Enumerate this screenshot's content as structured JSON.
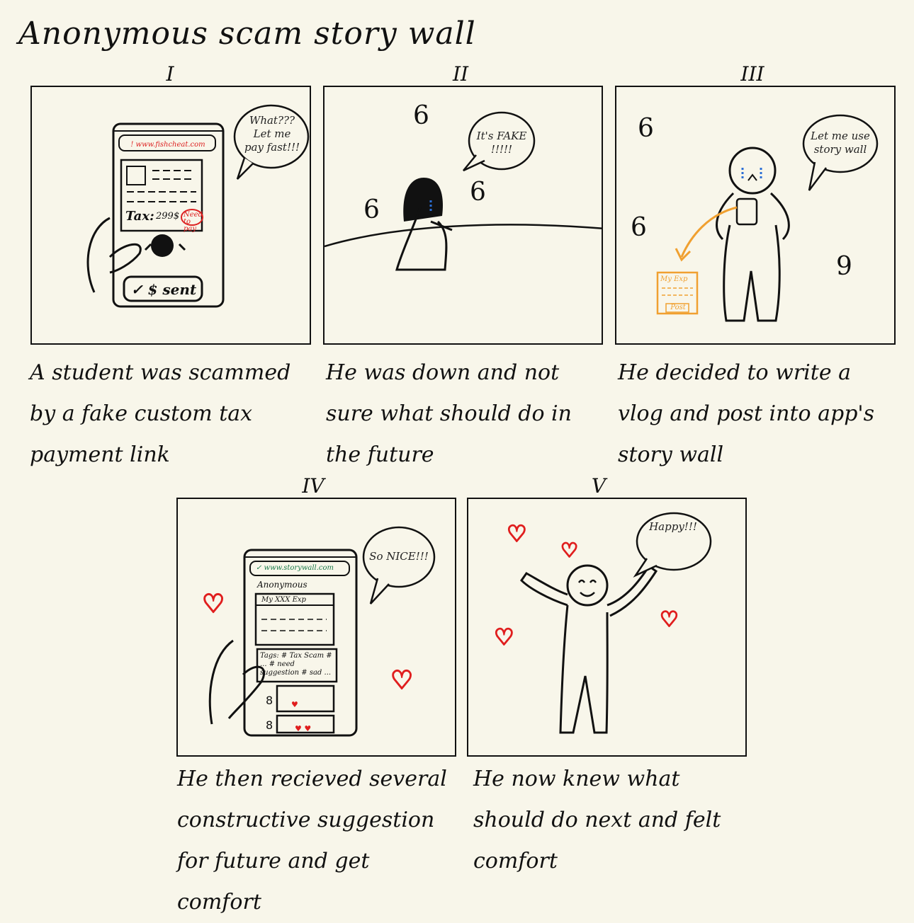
{
  "title": "Anonymous scam story wall",
  "colors": {
    "background": "#f8f6ea",
    "ink": "#111111",
    "heart": "#e01e1e",
    "tear": "#2b6fd6",
    "post_orange": "#f0a030",
    "url_red": "#d22222",
    "url_green": "#1a7a4a"
  },
  "panels": [
    {
      "numeral": "I",
      "bubble": "What??? Let me pay fast!!!",
      "url": "! www.fishcheat.com",
      "tax_label": "Tax:",
      "tax_value": "299$",
      "tax_note": "Need to pay",
      "sent_label": "✓ $ sent",
      "caption": "A student was scammed by a fake custom tax payment link"
    },
    {
      "numeral": "II",
      "bubble": "It's FAKE !!!!!",
      "caption": "He was down and not sure what should do in the future"
    },
    {
      "numeral": "III",
      "bubble": "Let me use story wall",
      "post_title": "My Exp",
      "post_button": "Post",
      "caption": "He decided to write a vlog and post into app's story wall"
    },
    {
      "numeral": "IV",
      "bubble": "So NICE!!!",
      "url": "✓ www.storywall.com",
      "user": "Anonymous",
      "post_title": "My XXX Exp",
      "tags": "Tags: # Tax Scam # ... # need suggestion # sad ...",
      "caption": "He then recieved several constructive suggestion for future and get comfort"
    },
    {
      "numeral": "V",
      "bubble": "Happy!!!",
      "caption": "He now knew what should do next and felt comfort"
    }
  ]
}
